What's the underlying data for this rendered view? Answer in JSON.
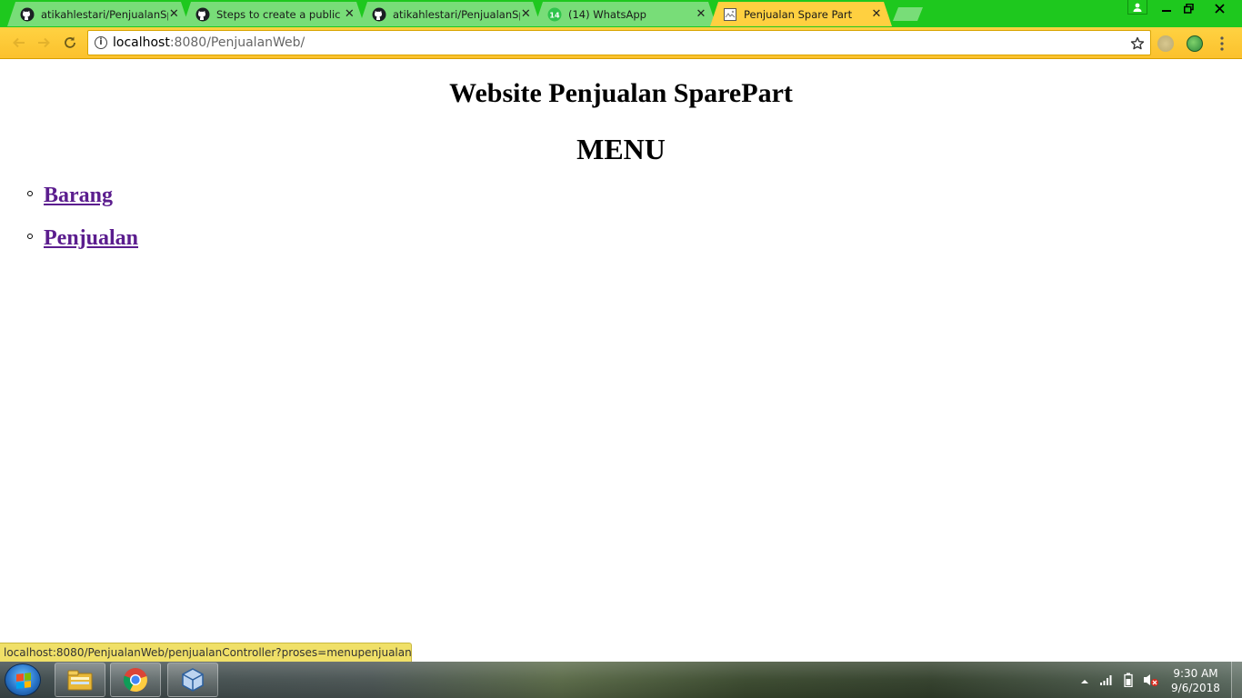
{
  "browser": {
    "tabs": [
      {
        "title": "atikahlestari/PenjualanSp",
        "icon": "github-icon"
      },
      {
        "title": "Steps to create a public g",
        "icon": "github-icon"
      },
      {
        "title": "atikahlestari/PenjualanSp",
        "icon": "github-icon"
      },
      {
        "title": "(14) WhatsApp",
        "icon": "whatsapp-icon",
        "badge": "14"
      },
      {
        "title": "Penjualan Spare Part",
        "icon": "page-icon",
        "active": true
      }
    ],
    "close_glyph": "✕",
    "url_host": "localhost",
    "url_rest": ":8080/PenjualanWeb/",
    "accent_color": "#1ec81e",
    "toolbar_color": "#fbc12d"
  },
  "page": {
    "title": "Website Penjualan SparePart",
    "heading": "MENU",
    "menu": [
      {
        "label": "Barang"
      },
      {
        "label": "Penjualan"
      }
    ],
    "link_color": "#5b1d8e"
  },
  "status_bar": {
    "url": "localhost:8080/PenjualanWeb/penjualanController?proses=menupenjualan"
  },
  "taskbar": {
    "apps": [
      "file-explorer-icon",
      "chrome-icon",
      "virtualbox-icon"
    ],
    "time": "9:30 AM",
    "date": "9/6/2018"
  }
}
